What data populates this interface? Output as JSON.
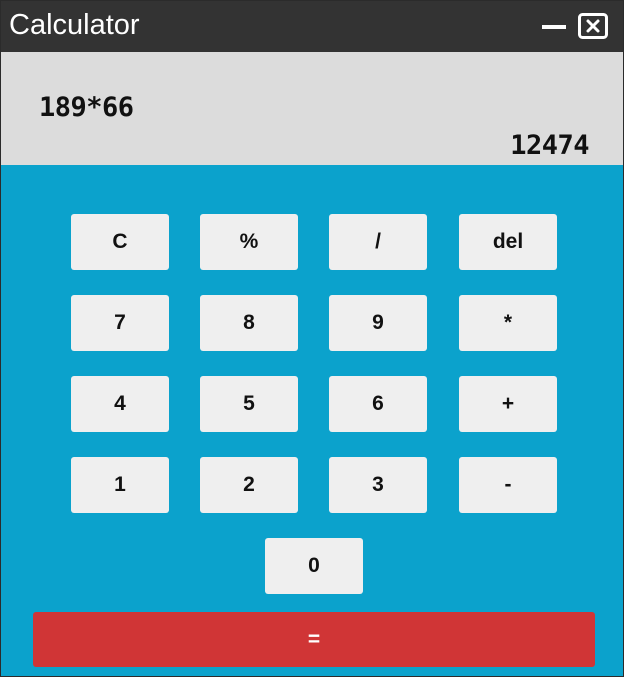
{
  "window": {
    "title": "Calculator"
  },
  "titlebar_icons": {
    "minimize": "minimize-icon",
    "close": "close-icon"
  },
  "display": {
    "expression": "189*66",
    "result": "12474"
  },
  "keys": {
    "clear": "C",
    "percent": "%",
    "divide": "/",
    "delete": "del",
    "seven": "7",
    "eight": "8",
    "nine": "9",
    "multiply": "*",
    "four": "4",
    "five": "5",
    "six": "6",
    "plus": "+",
    "one": "1",
    "two": "2",
    "three": "3",
    "minus": "-",
    "zero": "0",
    "equals": "="
  },
  "colors": {
    "titlebar": "#333333",
    "display_bg": "#dcdcdc",
    "keypad_bg": "#0ba2cc",
    "key_bg": "#efefef",
    "equals_bg": "#d03536"
  }
}
